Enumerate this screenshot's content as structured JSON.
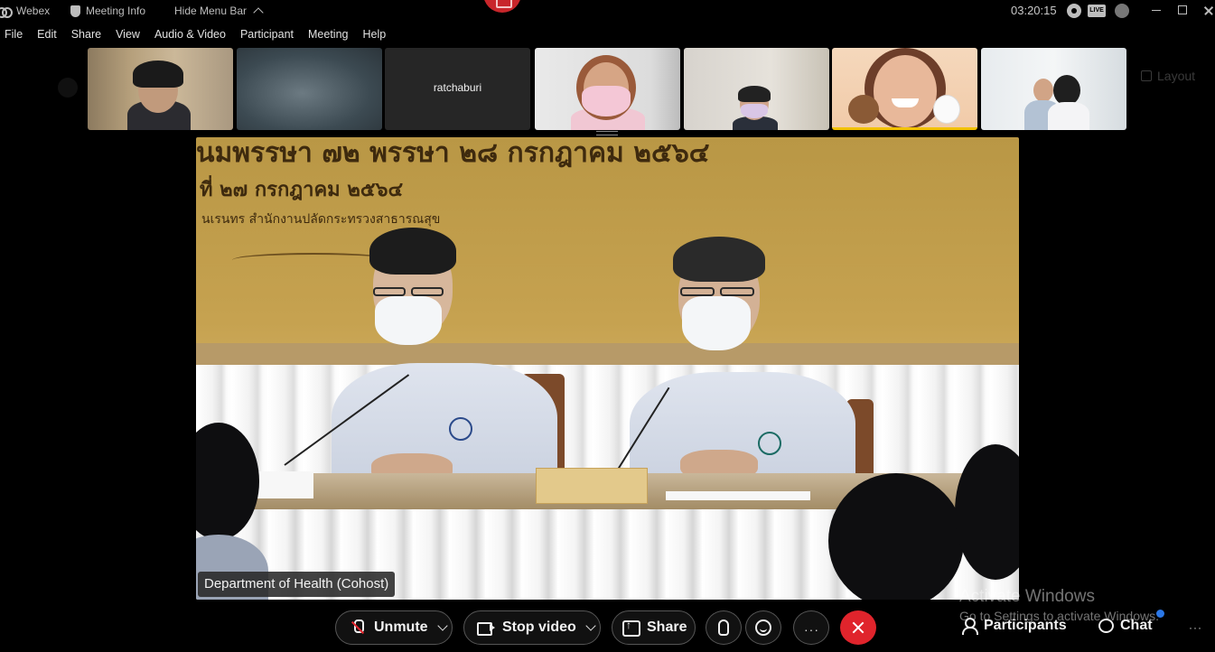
{
  "titlebar": {
    "app_name": "Webex",
    "meeting_info": "Meeting Info",
    "hide_menu_bar": "Hide Menu Bar",
    "clock": "03:20:15",
    "live_badge": "LIVE"
  },
  "menu": [
    "File",
    "Edit",
    "Share",
    "View",
    "Audio & Video",
    "Participant",
    "Meeting",
    "Help"
  ],
  "thumbnails": [
    {
      "name": "",
      "video": "participant-video"
    },
    {
      "name": "",
      "video": "blurred-video"
    },
    {
      "name": "ratchaburi",
      "video": "none"
    },
    {
      "name": "",
      "video": "participant-video"
    },
    {
      "name": "",
      "video": "participant-video"
    },
    {
      "name": "",
      "video": "participant-video"
    },
    {
      "name": "",
      "video": "participant-video"
    }
  ],
  "layout_button": "Layout",
  "main_video": {
    "banner_line_1": "นมพรรษา ๗๒ พรรษา ๒๘ กรกฎาคม ๒๕๖๔",
    "banner_line_2": "ที่ ๒๗ กรกฎาคม ๒๕๖๔",
    "banner_line_3": "นเรนทร สำนักงานปลัดกระทรวงสาธารณสุข",
    "speaker_label": "Department of Health (Cohost)"
  },
  "controls": {
    "unmute": "Unmute",
    "stop_video": "Stop video",
    "share": "Share",
    "participants": "Participants",
    "chat": "Chat"
  },
  "watermark": {
    "line1": "Activate Windows",
    "line2": "Go to Settings to activate Windows."
  },
  "colors": {
    "leave_button": "#e0242c",
    "record_indicator": "#c8262b",
    "background": "#000000"
  }
}
